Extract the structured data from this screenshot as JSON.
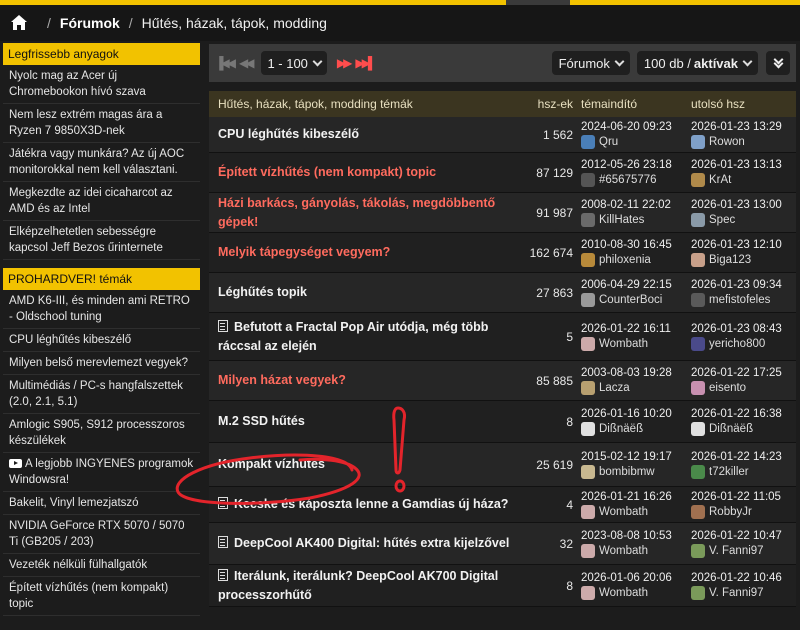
{
  "breadcrumb": {
    "items": [
      "Fórumok",
      "Hűtés, házak, tápok, modding"
    ]
  },
  "sidebar": {
    "section1_title": "Legfrissebb anyagok",
    "section1_items": [
      "Nyolc mag az Acer új Chromebookon hívó szava",
      "Nem lesz extrém magas ára a Ryzen 7 9850X3D-nek",
      "Játékra vagy munkára? Az új AOC monitorokkal nem kell választani.",
      "Megkezdte az idei cicaharcot az AMD és az Intel",
      "Elképzelhetetlen sebességre kapcsol Jeff Bezos űrinternete"
    ],
    "section2_title": "PROHARDVER! témák",
    "section2_items": [
      "AMD K6-III, és minden ami RETRO - Oldschool tuning",
      "CPU léghűtés kibeszélő",
      "Milyen belső merevlemezt vegyek?",
      "Multimédiás / PC-s hangfalszettek (2.0, 2.1, 5.1)",
      "Amlogic S905, S912 processzoros készülékek",
      "A legjobb INGYENES programok Windowsra!",
      "Bakelit, Vinyl lemezjatszó",
      "NVIDIA GeForce RTX 5070 / 5070 Ti (GB205 / 203)",
      "Vezeték nélküli fülhallgatók",
      "Épített vízhűtés (nem kompakt) topic"
    ]
  },
  "toolbar": {
    "range": "1 - 100",
    "forum_select": "Fórumok",
    "per_page": "100 db /",
    "filter": "aktívak"
  },
  "table": {
    "headers": {
      "title": "Hűtés, házak, tápok, modding témák",
      "count": "hsz-ek",
      "starter": "témaindító",
      "last": "utolsó hsz"
    },
    "rows": [
      {
        "title": "CPU léghűtés kibeszélő",
        "color": "white",
        "doc": false,
        "count": "1 562",
        "start_date": "2024-06-20 09:23",
        "start_user": "Qru",
        "start_av": "#4a7fb8",
        "last_date": "2026-01-23 13:29",
        "last_user": "Rowon",
        "last_av": "#7fa0c8"
      },
      {
        "title": "Épített vízhűtés (nem kompakt) topic",
        "color": "red",
        "doc": false,
        "count": "87 129",
        "start_date": "2012-05-26 23:18",
        "start_user": "#65675776",
        "start_av": "#555",
        "last_date": "2026-01-23 13:13",
        "last_user": "KrAt",
        "last_av": "#b08a4a"
      },
      {
        "title": "Házi barkács, gányolás, tákolás, megdöbbentő gépek!",
        "color": "red",
        "doc": false,
        "count": "91 987",
        "start_date": "2008-02-11 22:02",
        "start_user": "KillHates",
        "start_av": "#6a6a6a",
        "last_date": "2026-01-23 13:00",
        "last_user": "Spec",
        "last_av": "#8a9aa8"
      },
      {
        "title": "Melyik tápegységet vegyem?",
        "color": "red",
        "doc": false,
        "count": "162 674",
        "start_date": "2010-08-30 16:45",
        "start_user": "philoxenia",
        "start_av": "#b88a3a",
        "last_date": "2026-01-23 12:10",
        "last_user": "Biga123",
        "last_av": "#c8a08a"
      },
      {
        "title": "Léghűtés topik",
        "color": "white",
        "doc": false,
        "count": "27 863",
        "start_date": "2006-04-29 22:15",
        "start_user": "CounterBoci",
        "start_av": "#9a9a9a",
        "last_date": "2026-01-23 09:34",
        "last_user": "mefistofeles",
        "last_av": "#5a5a5a"
      },
      {
        "title": "Befutott a Fractal Pop Air utódja, még több ráccsal az elején",
        "color": "white",
        "doc": true,
        "count": "5",
        "start_date": "2026-01-22 16:11",
        "start_user": "Wombath",
        "start_av": "#caa",
        "last_date": "2026-01-23 08:43",
        "last_user": "yericho800",
        "last_av": "#4a4a8a"
      },
      {
        "title": "Milyen házat vegyek?",
        "color": "red",
        "doc": false,
        "count": "85 885",
        "start_date": "2003-08-03 19:28",
        "start_user": "Lacza",
        "start_av": "#b8a070",
        "last_date": "2026-01-22 17:25",
        "last_user": "eisento",
        "last_av": "#c890b0"
      },
      {
        "title": "M.2 SSD hűtés",
        "color": "white",
        "doc": false,
        "count": "8",
        "start_date": "2026-01-16 10:20",
        "start_user": "Dißnäëß",
        "start_av": "#e0e0e0",
        "last_date": "2026-01-22 16:38",
        "last_user": "Dißnäëß",
        "last_av": "#e0e0e0"
      },
      {
        "title": "Kompakt vízhűtés",
        "color": "white",
        "doc": false,
        "count": "25 619",
        "start_date": "2015-02-12 19:17",
        "start_user": "bombibmw",
        "start_av": "#c8b890",
        "last_date": "2026-01-22 14:23",
        "last_user": "t72killer",
        "last_av": "#4a8a4a"
      },
      {
        "title": "Kecske és káposzta lenne a Gamdias új háza?",
        "color": "white",
        "doc": true,
        "count": "4",
        "start_date": "2026-01-21 16:26",
        "start_user": "Wombath",
        "start_av": "#caa",
        "last_date": "2026-01-22 11:05",
        "last_user": "RobbyJr",
        "last_av": "#a07050"
      },
      {
        "title": "DeepCool AK400 Digital: hűtés extra kijelzővel",
        "color": "white",
        "doc": true,
        "count": "32",
        "start_date": "2023-08-08 10:53",
        "start_user": "Wombath",
        "start_av": "#caa",
        "last_date": "2026-01-22 10:47",
        "last_user": "V. Fanni97",
        "last_av": "#7a9a5a"
      },
      {
        "title": "Iterálunk, iterálunk? DeepCool AK700 Digital processzorhűtő",
        "color": "white",
        "doc": true,
        "count": "8",
        "start_date": "2026-01-06 20:06",
        "start_user": "Wombath",
        "start_av": "#caa",
        "last_date": "2026-01-22 10:46",
        "last_user": "V. Fanni97",
        "last_av": "#7a9a5a"
      }
    ]
  }
}
